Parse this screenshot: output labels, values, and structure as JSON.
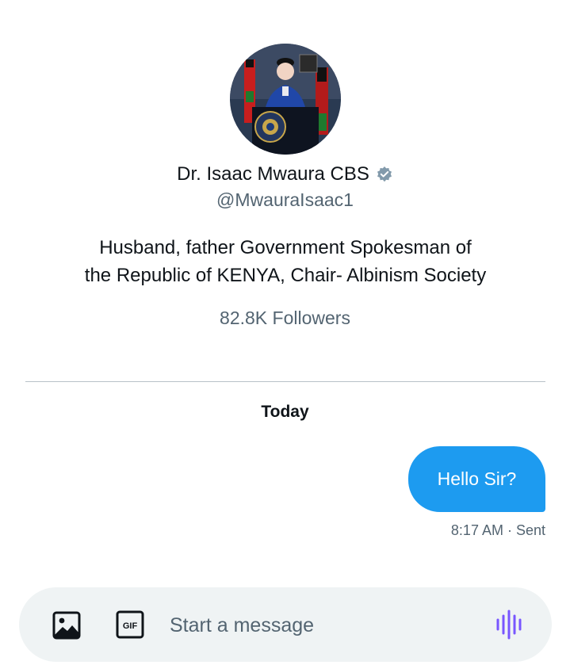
{
  "profile": {
    "name": "Dr. Isaac Mwaura CBS",
    "handle": "@MwauraIsaac1",
    "bio_line1": "Husband, father Government Spokesman of",
    "bio_line2": "the Republic of KENYA, Chair- Albinism Society",
    "followers": "82.8K Followers",
    "verified_icon": "verified-badge-icon"
  },
  "conversation": {
    "date_separator": "Today",
    "messages": [
      {
        "text": "Hello Sir?",
        "meta": "8:17 AM · Sent",
        "direction": "outgoing"
      }
    ]
  },
  "composer": {
    "placeholder": "Start a message",
    "media_icon": "image-icon",
    "gif_label": "GIF",
    "voice_icon": "voice-waveform-icon"
  },
  "colors": {
    "accent": "#1d9bf0",
    "voice": "#7856ff",
    "muted_text": "#536471",
    "composer_bg": "#eff3f4"
  }
}
